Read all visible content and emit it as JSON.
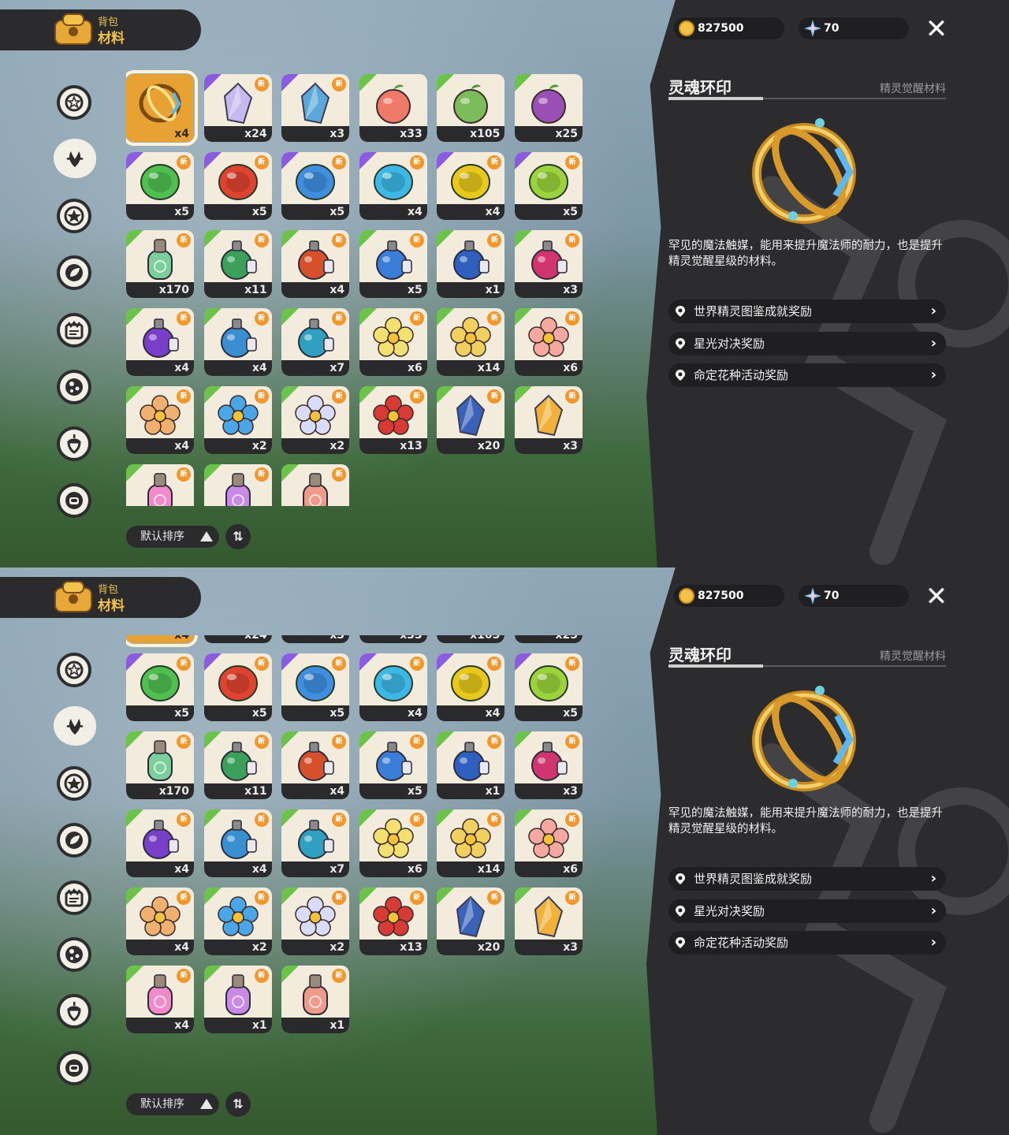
{
  "header": {
    "line1": "背包",
    "line2": "材料"
  },
  "currency": {
    "gold": "827500",
    "gems": "70"
  },
  "categories": [
    "star-badge-icon",
    "leaf-spirit-icon",
    "star-ring-icon",
    "leaf-icon",
    "crown-scroll-icon",
    "dots-ball-icon",
    "acorn-icon",
    "chair-icon"
  ],
  "sort": {
    "label": "默认排序",
    "toggle": "⇅"
  },
  "detail": {
    "name": "灵魂环印",
    "type": "精灵觉醒材料",
    "description": "罕见的魔法触媒，能用来提升魔法师的耐力，也是提升精灵觉醒星级的材料。",
    "sources": [
      "世界精灵图鉴成就奖励",
      "星光对决奖励",
      "命定花种活动奖励"
    ]
  },
  "items": [
    {
      "qty": "x4",
      "kind": "ring",
      "color": "#e6a43a",
      "new": false,
      "corner": "",
      "sel": true
    },
    {
      "qty": "x24",
      "kind": "crystal",
      "color": "#c6b9f0",
      "new": true,
      "corner": "p"
    },
    {
      "qty": "x3",
      "kind": "crystal",
      "color": "#5aa8d8",
      "new": true,
      "corner": "p"
    },
    {
      "qty": "x33",
      "kind": "fruit",
      "color": "#f07a6a",
      "new": false,
      "corner": "g"
    },
    {
      "qty": "x105",
      "kind": "fruit",
      "color": "#7bbd5a",
      "new": false,
      "corner": "g"
    },
    {
      "qty": "x25",
      "kind": "fruit",
      "color": "#9a4fb5",
      "new": false,
      "corner": "g"
    },
    {
      "qty": "x5",
      "kind": "stone",
      "color": "#4fbf4f",
      "new": true,
      "corner": "p"
    },
    {
      "qty": "x5",
      "kind": "stone",
      "color": "#e0432f",
      "new": true,
      "corner": "p"
    },
    {
      "qty": "x5",
      "kind": "stone",
      "color": "#3f8fe0",
      "new": true,
      "corner": "p"
    },
    {
      "qty": "x4",
      "kind": "stone",
      "color": "#3db8e6",
      "new": true,
      "corner": "p"
    },
    {
      "qty": "x4",
      "kind": "stone",
      "color": "#e8c81c",
      "new": true,
      "corner": "p"
    },
    {
      "qty": "x5",
      "kind": "stone",
      "color": "#9bd33c",
      "new": true,
      "corner": "p"
    },
    {
      "qty": "x170",
      "kind": "bottle",
      "color": "#7ccf9a",
      "new": true,
      "corner": "g"
    },
    {
      "qty": "x11",
      "kind": "potion",
      "color": "#3aa05a",
      "new": true,
      "corner": "g"
    },
    {
      "qty": "x4",
      "kind": "potion",
      "color": "#d6502c",
      "new": true,
      "corner": "g"
    },
    {
      "qty": "x5",
      "kind": "potion",
      "color": "#3a7ed8",
      "new": true,
      "corner": "g"
    },
    {
      "qty": "x1",
      "kind": "potion",
      "color": "#2f5fbf",
      "new": true,
      "corner": "g"
    },
    {
      "qty": "x3",
      "kind": "potion",
      "color": "#d0356f",
      "new": true,
      "corner": "g"
    },
    {
      "qty": "x4",
      "kind": "potion",
      "color": "#7a3fc8",
      "new": true,
      "corner": "g"
    },
    {
      "qty": "x4",
      "kind": "potion",
      "color": "#3a8fd0",
      "new": true,
      "corner": "g"
    },
    {
      "qty": "x7",
      "kind": "potion",
      "color": "#2fa0c0",
      "new": true,
      "corner": "g"
    },
    {
      "qty": "x6",
      "kind": "flower",
      "color": "#f4e070",
      "new": true,
      "corner": "g"
    },
    {
      "qty": "x14",
      "kind": "flower",
      "color": "#f2d060",
      "new": true,
      "corner": "g"
    },
    {
      "qty": "x6",
      "kind": "flower",
      "color": "#f4a8a0",
      "new": true,
      "corner": "g"
    },
    {
      "qty": "x4",
      "kind": "flower",
      "color": "#f0b070",
      "new": true,
      "corner": "g"
    },
    {
      "qty": "x2",
      "kind": "flower",
      "color": "#4aa6e6",
      "new": true,
      "corner": "g"
    },
    {
      "qty": "x2",
      "kind": "flower",
      "color": "#d8dcf8",
      "new": true,
      "corner": "g"
    },
    {
      "qty": "x13",
      "kind": "flower",
      "color": "#d83a35",
      "new": true,
      "corner": "g"
    },
    {
      "qty": "x20",
      "kind": "crystal",
      "color": "#3a62b8",
      "new": true,
      "corner": "g"
    },
    {
      "qty": "x3",
      "kind": "crystal",
      "color": "#f2b23a",
      "new": true,
      "corner": "g"
    },
    {
      "qty": "x4",
      "kind": "bottle",
      "color": "#f08ac8",
      "new": true,
      "corner": "g"
    },
    {
      "qty": "x1",
      "kind": "bottle",
      "color": "#c98ae6",
      "new": true,
      "corner": "g"
    },
    {
      "qty": "x1",
      "kind": "bottle",
      "color": "#f09a8a",
      "new": true,
      "corner": "g"
    }
  ]
}
